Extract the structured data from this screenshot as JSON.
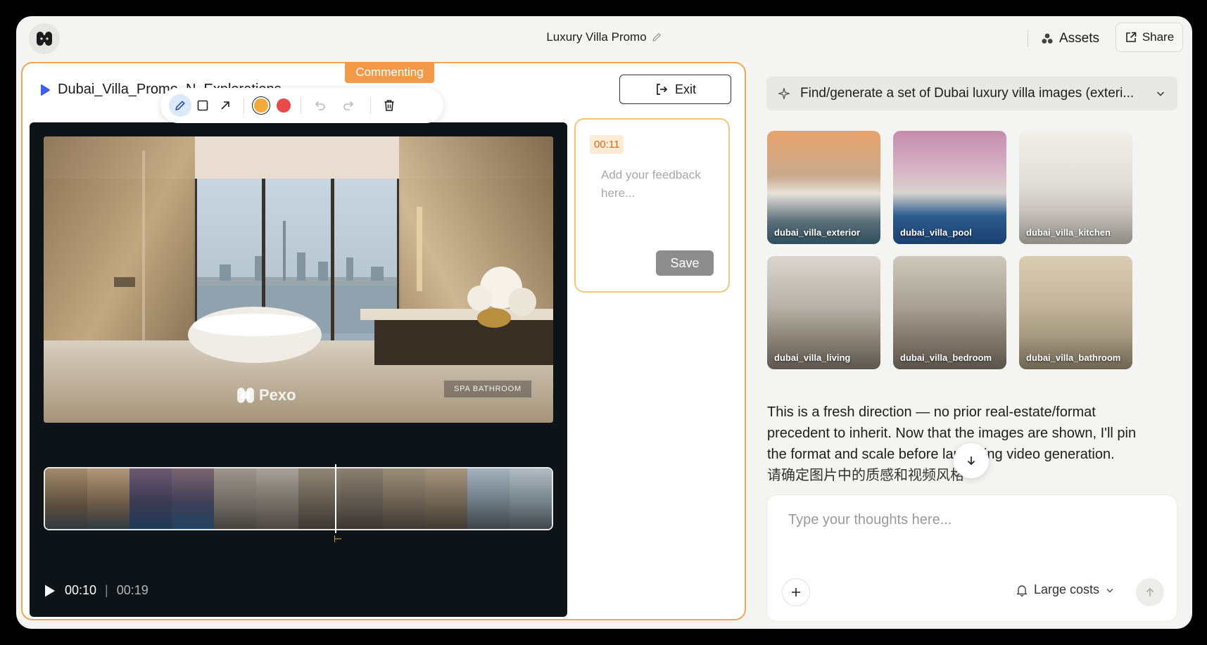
{
  "header": {
    "title": "Luxury Villa Promo",
    "assets_label": "Assets",
    "share_label": "Share"
  },
  "editor": {
    "mode_tag": "Commenting",
    "file_name": "Dubai_Villa_Promo_N_Explorations",
    "exit_label": "Exit",
    "toolbar": {
      "colors": [
        "#f4a93c",
        "#e84a4a"
      ],
      "selected_color": "#f4a93c"
    },
    "video": {
      "watermark": "Pexo",
      "scene_label": "SPA BATHROOM",
      "current_time": "00:10",
      "total_time": "00:19",
      "progress": 0.568
    },
    "comment": {
      "timestamp": "00:11",
      "placeholder": "Add your feedback here...",
      "save_label": "Save"
    }
  },
  "chat": {
    "prompt_summary": "Find/generate a set of Dubai luxury villa images (exteri...",
    "images": [
      {
        "caption": "dubai_villa_exterior"
      },
      {
        "caption": "dubai_villa_pool"
      },
      {
        "caption": "dubai_villa_kitchen"
      },
      {
        "caption": "dubai_villa_living"
      },
      {
        "caption": "dubai_villa_bedroom"
      },
      {
        "caption": "dubai_villa_bathroom"
      }
    ],
    "message": "This is a fresh direction — no prior real-estate/format precedent to inherit. Now that the images are shown, I'll pin the format and scale before launching video generation.",
    "message_cjk": "请确定图片中的质感和视频风格",
    "composer": {
      "placeholder": "Type your thoughts here...",
      "cost_label": "Large costs"
    }
  }
}
